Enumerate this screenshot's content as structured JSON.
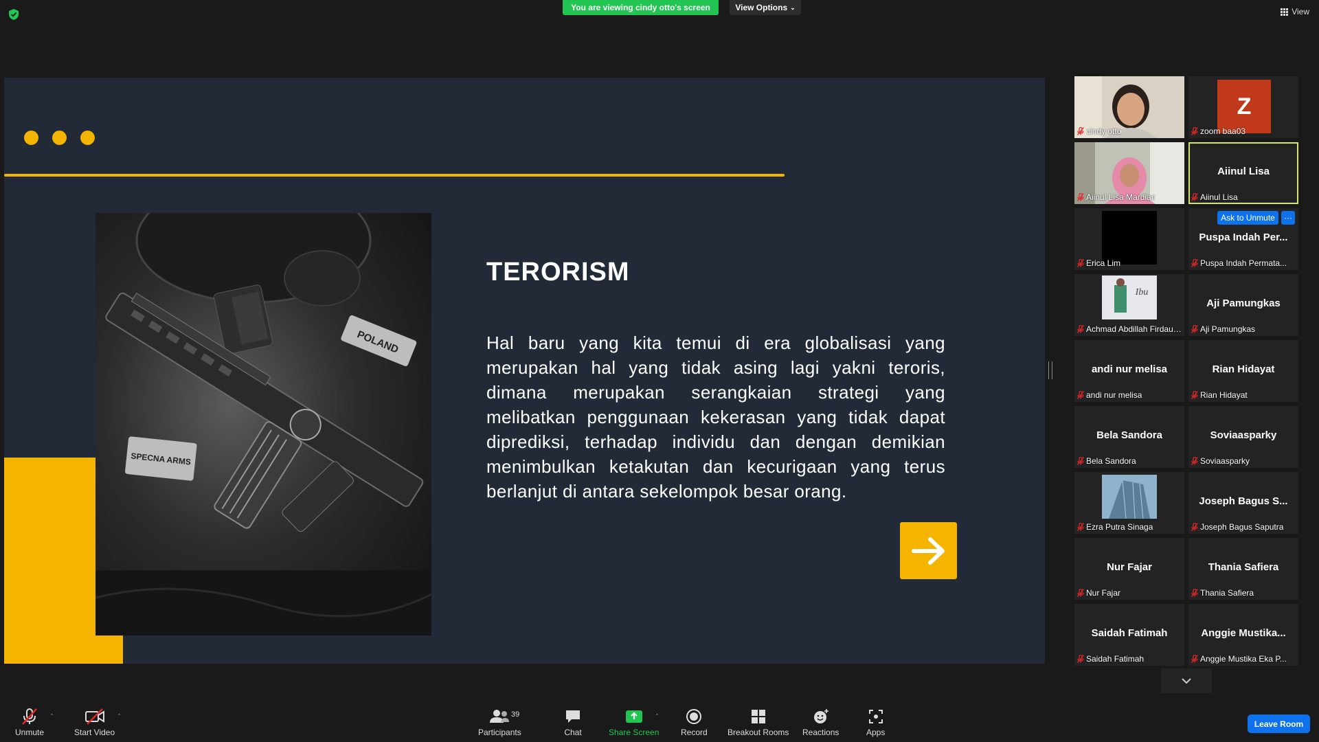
{
  "banner": {
    "viewing_text": "You are viewing cindy otto's screen",
    "view_options_label": "View Options"
  },
  "view_button_label": "View",
  "slide": {
    "title": "TERORISM",
    "body": "Hal baru yang kita temui di era globalisasi yang merupakan hal yang tidak asing lagi yakni teroris, dimana merupakan serangkaian strategi yang melibatkan penggunaan kekerasan yang tidak dapat diprediksi, terhadap individu dan dengan demikian menimbulkan ketakutan dan kecurigaan yang terus berlanjut di antara sekelompok besar orang.",
    "patch_poland": "POLAND",
    "patch_specna": "SPECNA ARMS",
    "accent_color": "#f4b400",
    "background_color": "#232a37"
  },
  "participants": [
    {
      "label": "cindy otto",
      "big": "",
      "kind": "video-girl"
    },
    {
      "label": "zoom baa03",
      "big": "",
      "kind": "avatar",
      "initial": "Z"
    },
    {
      "label": "Aiinul Lisa Mardian",
      "big": "",
      "kind": "video-hijab"
    },
    {
      "label": "Aiinul Lisa",
      "big": "Aiinul Lisa",
      "kind": "name",
      "active": true
    },
    {
      "label": "Erica Lim",
      "big": "",
      "kind": "black"
    },
    {
      "label": "Puspa Indah Permata...",
      "big": "Puspa Indah Per...",
      "kind": "name"
    },
    {
      "label": "Achmad Abdillah Firdaus...",
      "big": "",
      "kind": "poster",
      "poster_text": "Ibu"
    },
    {
      "label": "Aji Pamungkas",
      "big": "Aji Pamungkas",
      "kind": "name"
    },
    {
      "label": "andi nur melisa",
      "big": "andi nur melisa",
      "kind": "name"
    },
    {
      "label": "Rian Hidayat",
      "big": "Rian Hidayat",
      "kind": "name"
    },
    {
      "label": "Bela Sandora",
      "big": "Bela Sandora",
      "kind": "name"
    },
    {
      "label": "Soviaasparky",
      "big": "Soviaasparky",
      "kind": "name"
    },
    {
      "label": "Ezra Putra Sinaga",
      "big": "",
      "kind": "building"
    },
    {
      "label": "Joseph Bagus Saputra",
      "big": "Joseph Bagus S...",
      "kind": "name"
    },
    {
      "label": "Nur Fajar",
      "big": "Nur Fajar",
      "kind": "name"
    },
    {
      "label": "Thania Safiera",
      "big": "Thania Safiera",
      "kind": "name"
    },
    {
      "label": "Saidah Fatimah",
      "big": "Saidah Fatimah",
      "kind": "name"
    },
    {
      "label": "Anggie Mustika Eka P...",
      "big": "Anggie  Mustika...",
      "kind": "name"
    }
  ],
  "ask_unmute_label": "Ask to Unmute",
  "more_label": "···",
  "toolbar": {
    "unmute": "Unmute",
    "start_video": "Start Video",
    "participants": "Participants",
    "participants_count": "39",
    "chat": "Chat",
    "share_screen": "Share Screen",
    "record": "Record",
    "breakout_rooms": "Breakout Rooms",
    "reactions": "Reactions",
    "apps": "Apps",
    "leave_room": "Leave Room"
  }
}
